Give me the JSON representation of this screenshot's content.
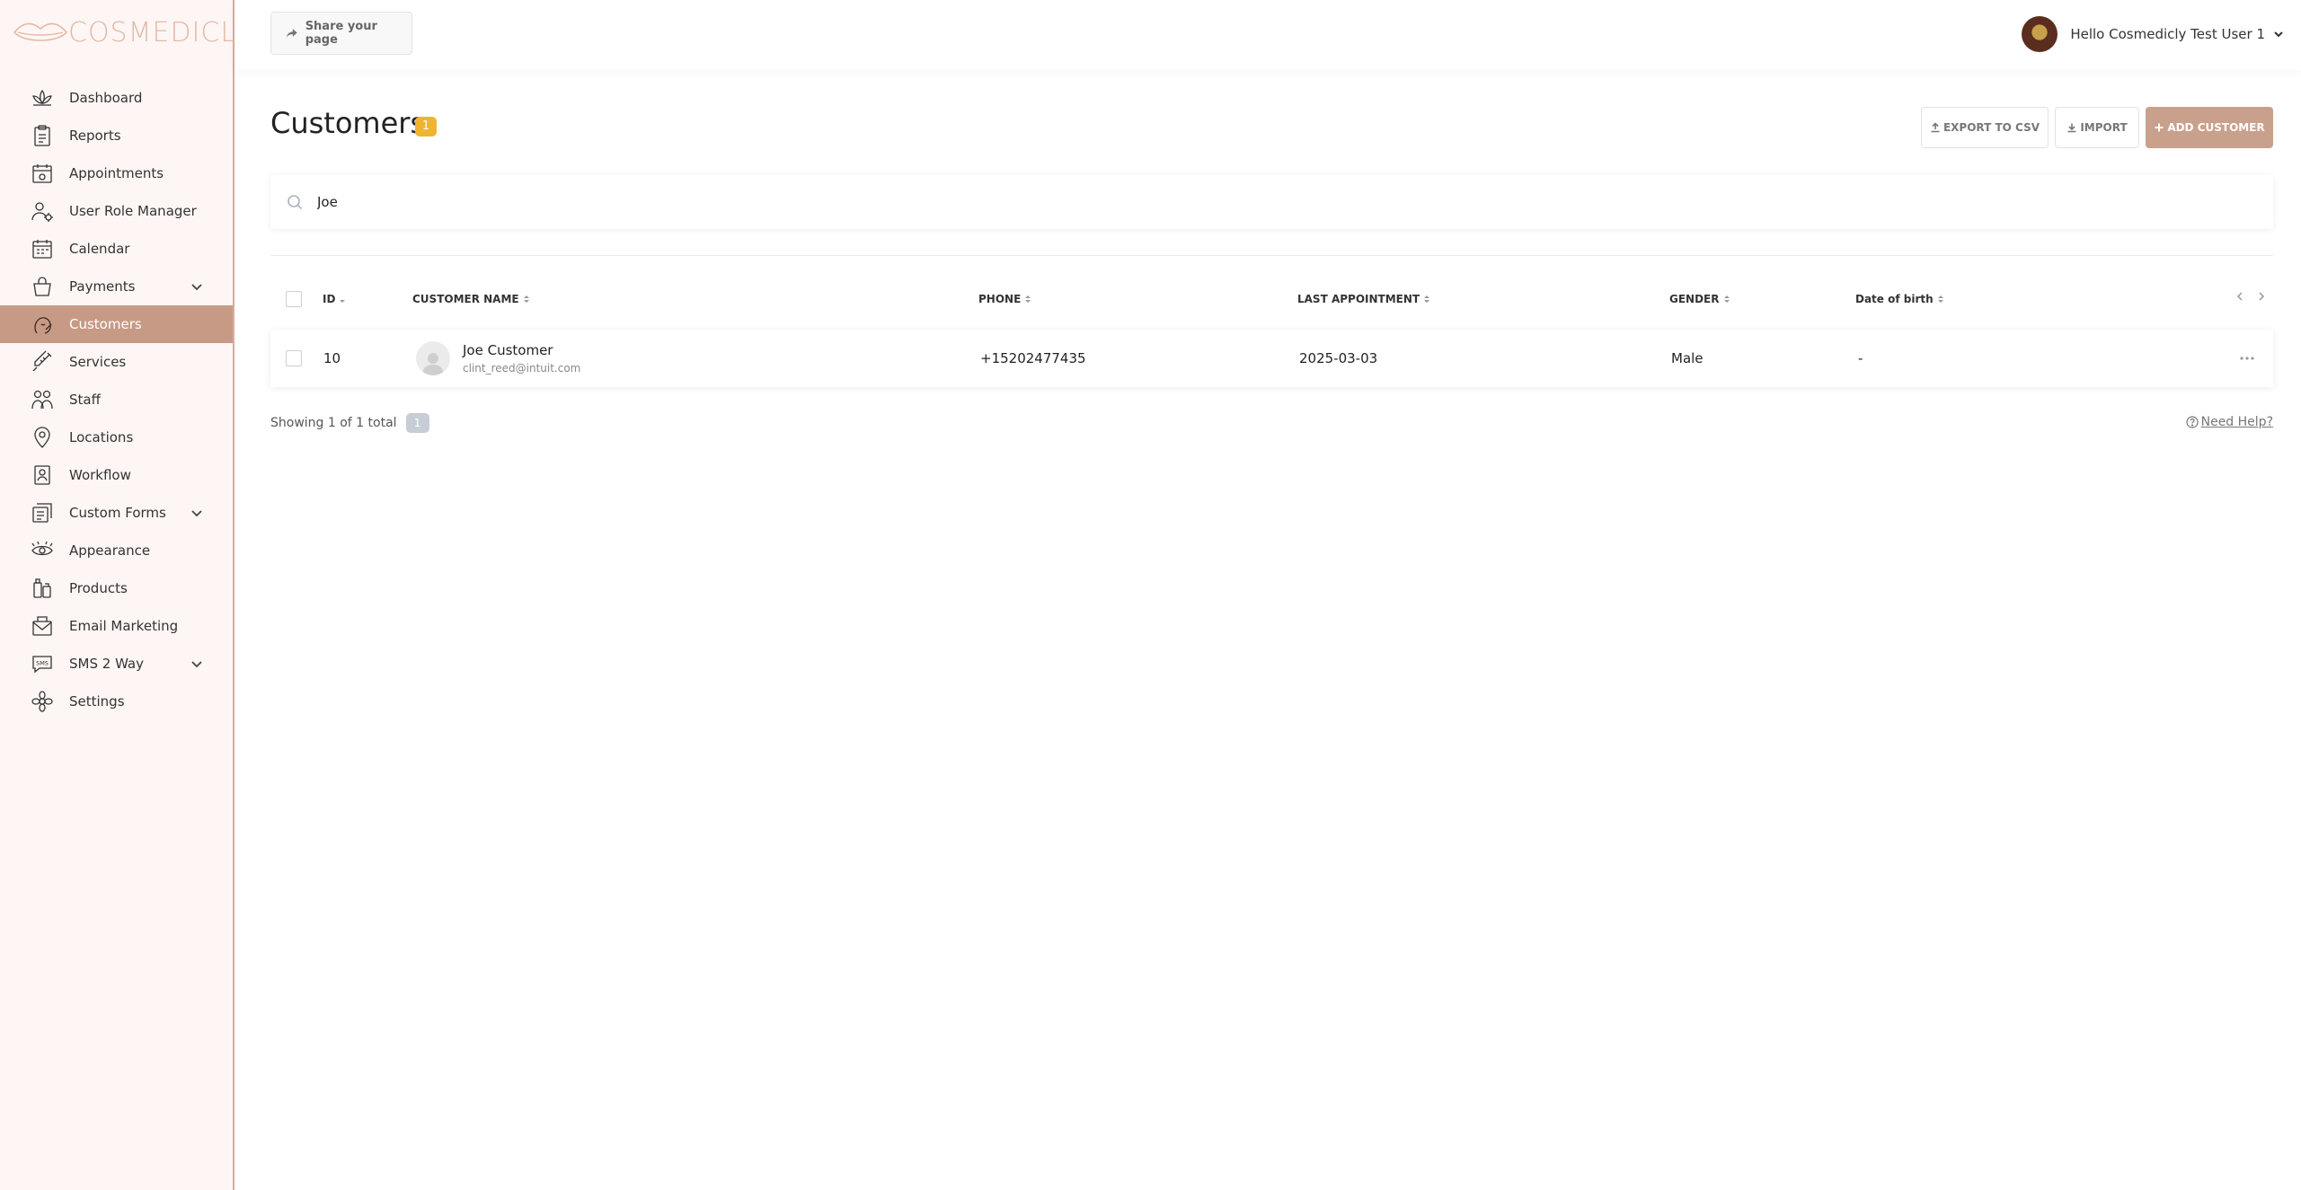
{
  "app": {
    "brand": "COSMEDICLY",
    "accent_color": "#c69a85",
    "badge_color": "#f0b430"
  },
  "sidebar": {
    "items": [
      {
        "label": "Dashboard",
        "icon": "lotus-icon",
        "active": false,
        "expandable": false
      },
      {
        "label": "Reports",
        "icon": "clipboard-icon",
        "active": false,
        "expandable": false
      },
      {
        "label": "Appointments",
        "icon": "appointment-calendar-icon",
        "active": false,
        "expandable": false
      },
      {
        "label": "User Role Manager",
        "icon": "user-role-icon",
        "active": false,
        "expandable": false
      },
      {
        "label": "Calendar",
        "icon": "calendar-icon",
        "active": false,
        "expandable": false
      },
      {
        "label": "Payments",
        "icon": "handbag-icon",
        "active": false,
        "expandable": true
      },
      {
        "label": "Customers",
        "icon": "customer-face-icon",
        "active": true,
        "expandable": false
      },
      {
        "label": "Services",
        "icon": "syringe-icon",
        "active": false,
        "expandable": false
      },
      {
        "label": "Staff",
        "icon": "staff-icon",
        "active": false,
        "expandable": false
      },
      {
        "label": "Locations",
        "icon": "location-pin-icon",
        "active": false,
        "expandable": false
      },
      {
        "label": "Workflow",
        "icon": "workflow-icon",
        "active": false,
        "expandable": false
      },
      {
        "label": "Custom Forms",
        "icon": "forms-icon",
        "active": false,
        "expandable": true
      },
      {
        "label": "Appearance",
        "icon": "eye-icon",
        "active": false,
        "expandable": false
      },
      {
        "label": "Products",
        "icon": "products-icon",
        "active": false,
        "expandable": false
      },
      {
        "label": "Email Marketing",
        "icon": "email-icon",
        "active": false,
        "expandable": false
      },
      {
        "label": "SMS 2 Way",
        "icon": "sms-icon",
        "active": false,
        "expandable": true,
        "icon_text": "SMS"
      },
      {
        "label": "Settings",
        "icon": "flower-settings-icon",
        "active": false,
        "expandable": false
      }
    ]
  },
  "topbar": {
    "share_label": "Share your page",
    "greeting": "Hello Cosmedicly Test User 1"
  },
  "page": {
    "title": "Customers",
    "count": "1",
    "export_label": "EXPORT TO CSV",
    "import_label": "IMPORT",
    "add_label": "ADD CUSTOMER"
  },
  "search": {
    "value": "Joe"
  },
  "table": {
    "columns": {
      "id": "ID",
      "name": "CUSTOMER NAME",
      "phone": "PHONE",
      "last_appointment": "LAST APPOINTMENT",
      "gender": "GENDER",
      "dob": "Date of birth"
    },
    "rows": [
      {
        "id": "10",
        "name": "Joe Customer",
        "email": "clint_reed@intuit.com",
        "phone": "+15202477435",
        "last_appointment": "2025-03-03",
        "gender": "Male",
        "dob": "-"
      }
    ]
  },
  "footer": {
    "showing": "Showing 1 of 1 total",
    "page": "1",
    "help": "Need Help?"
  }
}
